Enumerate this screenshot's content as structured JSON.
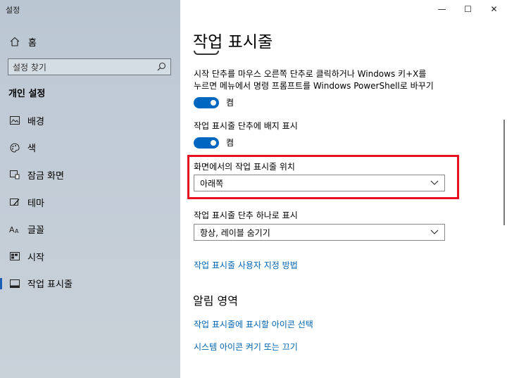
{
  "window": {
    "app_title": "설정",
    "minimize": "—",
    "maximize": "☐",
    "close": "✕"
  },
  "sidebar": {
    "home_label": "홈",
    "search_placeholder": "설정 찾기",
    "section": "개인 설정",
    "items": [
      {
        "label": "배경",
        "icon": "picture-icon"
      },
      {
        "label": "색",
        "icon": "palette-icon"
      },
      {
        "label": "잠금 화면",
        "icon": "lock-screen-icon"
      },
      {
        "label": "테마",
        "icon": "theme-brush-icon"
      },
      {
        "label": "글꼴",
        "icon": "font-icon"
      },
      {
        "label": "시작",
        "icon": "start-icon"
      },
      {
        "label": "작업 표시줄",
        "icon": "taskbar-icon",
        "active": true
      }
    ]
  },
  "main": {
    "title": "작업 표시줄",
    "powershell_desc_line1": "시작 단추를 마우스 오른쪽 단추로 클릭하거나 Windows 키+X를",
    "powershell_desc_line2": "누르면 메뉴에서 명령 프롬프트를 Windows PowerShell로 바꾸기",
    "powershell_toggle": {
      "state": "켬",
      "on": true
    },
    "badges_label": "작업 표시줄 단추에 배지 표시",
    "badges_toggle": {
      "state": "켬",
      "on": true
    },
    "location_label": "화면에서의 작업 표시줄 위치",
    "location_value": "아래쪽",
    "combine_label": "작업 표시줄 단추 하나로 표시",
    "combine_value": "항상, 레이블 숨기기",
    "customize_link": "작업 표시줄 사용자 지정 방법",
    "notification_heading": "알림 영역",
    "select_icons_link": "작업 표시줄에 표시할 아이콘 선택",
    "system_icons_link": "시스템 아이콘 켜기 또는 끄기"
  },
  "colors": {
    "accent": "#0067c0",
    "link": "#0063b1",
    "highlight": "#e81123"
  }
}
